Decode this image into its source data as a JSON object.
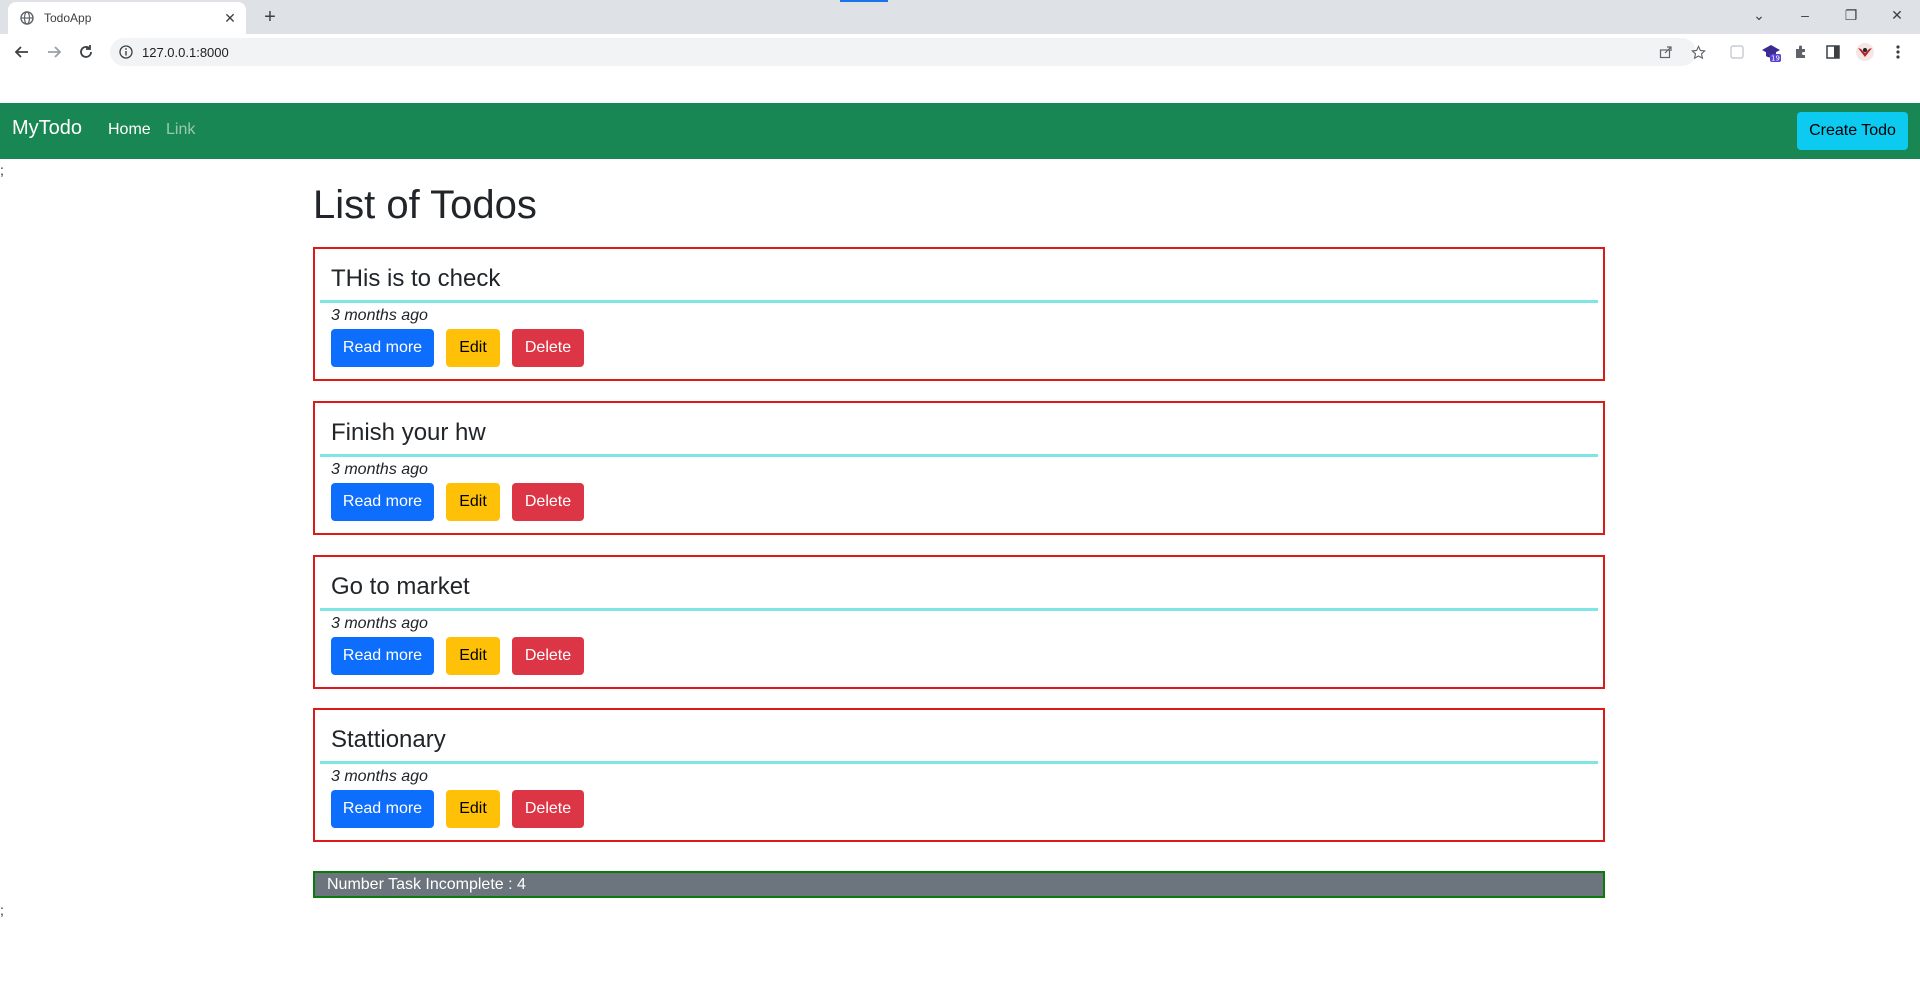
{
  "browser": {
    "tab_title": "TodoApp",
    "tab_close": "✕",
    "new_tab": "+",
    "url": "127.0.0.1:8000",
    "window_controls": {
      "tab_search": "⌄",
      "minimize": "–",
      "restore": "❐",
      "close": "✕"
    },
    "extension_badge": "19"
  },
  "navbar": {
    "brand": "MyTodo",
    "links": [
      "Home",
      "Link"
    ],
    "create_button": "Create Todo",
    "color": "#198754"
  },
  "stray_text": ";",
  "main": {
    "title": "List of Todos",
    "todos": [
      {
        "title": "THis is to check",
        "time": "3 months ago"
      },
      {
        "title": "Finish your hw",
        "time": "3 months ago"
      },
      {
        "title": "Go to market",
        "time": "3 months ago"
      },
      {
        "title": "Stattionary",
        "time": "3 months ago"
      }
    ],
    "buttons": {
      "read_more": "Read more",
      "edit": "Edit",
      "delete": "Delete"
    },
    "incomplete_text": "Number Task Incomplete : 4"
  }
}
